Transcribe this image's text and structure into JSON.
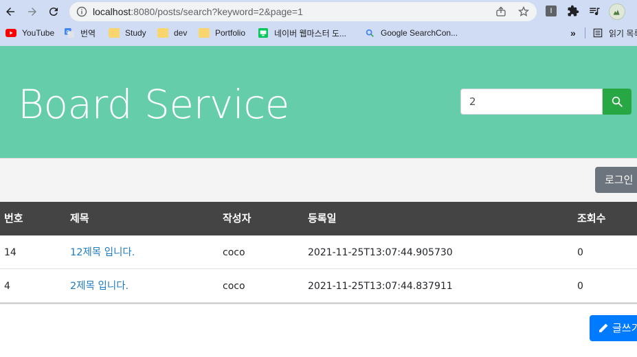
{
  "browser": {
    "url_host": "localhost",
    "url_path": ":8080/posts/search?keyword=2&page=1",
    "bookmarks": [
      {
        "label": "YouTube",
        "icon": "youtube-icon"
      },
      {
        "label": "번역",
        "icon": "google-translate-icon"
      },
      {
        "label": "Study",
        "icon": "folder-icon"
      },
      {
        "label": "dev",
        "icon": "folder-icon"
      },
      {
        "label": "Portfolio",
        "icon": "folder-icon"
      },
      {
        "label": "네이버 웹마스터 도...",
        "icon": "naver-webmaster-icon"
      },
      {
        "label": "Google SearchCon...",
        "icon": "google-search-console-icon"
      }
    ],
    "more_bookmarks": "»",
    "reading_list": "읽기 목록"
  },
  "header": {
    "title": "Board Service",
    "search_value": "2"
  },
  "auth": {
    "login_label": "로그인"
  },
  "table": {
    "columns": [
      "번호",
      "제목",
      "작성자",
      "등록일",
      "조회수"
    ],
    "rows": [
      {
        "no": "14",
        "title": "12제목 입니다.",
        "author": "coco",
        "date": "2021-11-25T13:07:44.905730",
        "views": "0"
      },
      {
        "no": "4",
        "title": "2제목 입니다.",
        "author": "coco",
        "date": "2021-11-25T13:07:44.837911",
        "views": "0"
      }
    ]
  },
  "actions": {
    "write_label": "글쓰기"
  },
  "colors": {
    "hero": "#66cdaa",
    "search_button": "#28a745",
    "login_button": "#6c757d",
    "write_button": "#007bff",
    "table_header": "#444444",
    "link": "#1f7bbf"
  }
}
